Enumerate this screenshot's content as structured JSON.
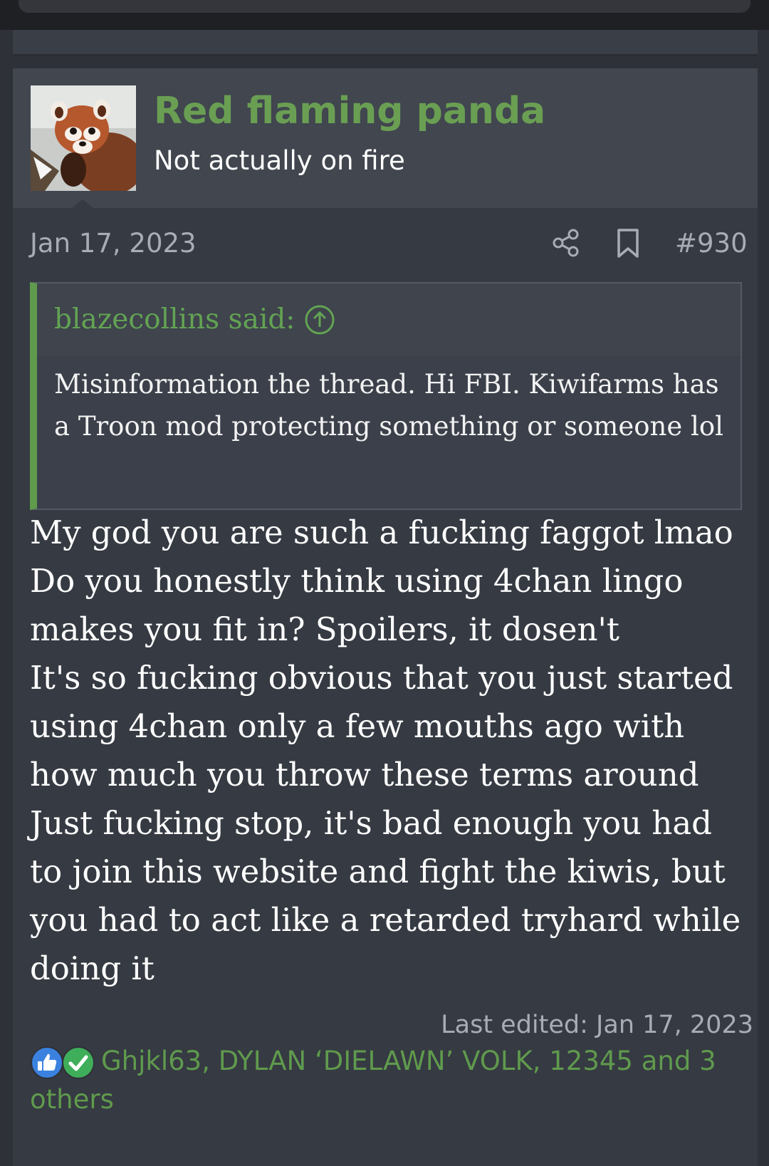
{
  "post": {
    "username": "Red flaming panda",
    "user_title": "Not actually on fire",
    "date": "Jan 17, 2023",
    "post_number": "#930",
    "icons": {
      "share": "share-icon",
      "bookmark": "bookmark-icon",
      "avatar": "red-panda-avatar"
    },
    "quote": {
      "author_said": "blazecollins said:",
      "jump_icon": "arrow-up-circle-icon",
      "text": "Misinformation the thread. Hi FBI. Kiwifarms has a Troon mod protecting something or someone lol"
    },
    "body_lines": [
      "My god you are such a fucking faggot lmao",
      "Do you honestly think using 4chan lingo",
      "makes you fit in? Spoilers, it dosen't",
      "It's so fucking obvious that you just started",
      "using 4chan only a few mouths ago with",
      "how much you throw these terms around",
      "Just fucking stop, it's bad enough you had",
      "to join this website and fight the kiwis, but",
      "you had to act like a retarded tryhard while",
      "doing it"
    ],
    "last_edited": "Last edited: Jan 17, 2023",
    "reactions": {
      "icons": [
        "like-icon",
        "agree-check-icon"
      ],
      "users": "Ghjkl63, DYLAN ‘DIELAWN’ VOLK, 12345 and 3 others"
    }
  },
  "colors": {
    "accent_green": "#6a9f53",
    "background": "#363a42",
    "header_bg": "#41464f",
    "muted_text": "#a8adb5"
  }
}
